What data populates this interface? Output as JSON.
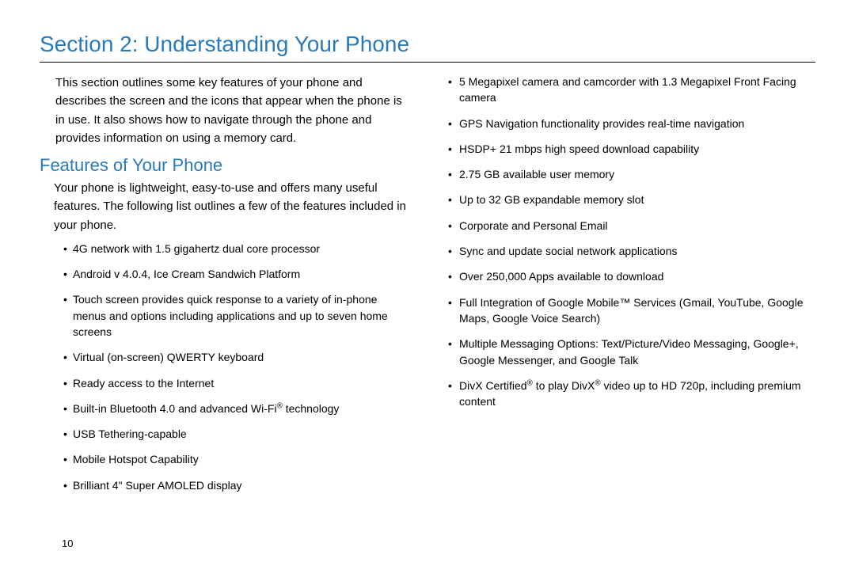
{
  "section_title": "Section 2: Understanding Your Phone",
  "intro": "This section outlines some key features of your phone and describes the screen and the icons that appear when the phone is in use. It also shows how to navigate through the phone and provides information on using a memory card.",
  "sub_title": "Features of Your Phone",
  "sub_intro": "Your phone is lightweight, easy-to-use and offers many useful features. The following list outlines a few of the features included in your phone.",
  "features_left": [
    "4G network with 1.5 gigahertz dual core processor",
    "Android v 4.0.4, Ice Cream Sandwich Platform",
    "Touch screen provides quick response to a variety of in-phone menus and options including applications and up to seven home screens",
    "Virtual (on-screen) QWERTY keyboard",
    "Ready access to the Internet",
    "Built-in Bluetooth 4.0 and advanced Wi-Fi® technology",
    "USB Tethering-capable",
    "Mobile Hotspot Capability",
    "Brilliant 4\" Super AMOLED display"
  ],
  "features_right": [
    "5 Megapixel camera and camcorder with 1.3 Megapixel Front Facing camera",
    "GPS Navigation functionality provides real-time navigation",
    "HSDP+ 21 mbps high speed download capability",
    "2.75 GB available user memory",
    "Up to 32 GB expandable memory slot",
    "Corporate and Personal Email",
    "Sync and update social network applications",
    "Over 250,000 Apps available to download",
    "Full Integration of Google Mobile™ Services (Gmail, YouTube, Google Maps, Google Voice Search)",
    "Multiple Messaging Options: Text/Picture/Video Messaging, Google+, Google Messenger, and Google Talk",
    "DivX Certified® to play DivX® video up to HD 720p, including premium content"
  ],
  "page_number": "10"
}
